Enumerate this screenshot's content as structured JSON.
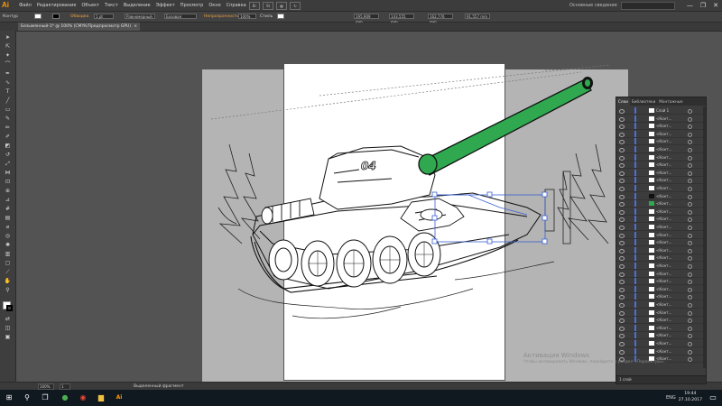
{
  "app": {
    "logo": "Ai",
    "workspace": "Основные сведения",
    "window_controls": [
      "—",
      "❐",
      "✕"
    ]
  },
  "menu": [
    "Файл",
    "Редактирование",
    "Объект",
    "Текст",
    "Выделение",
    "Эффект",
    "Просмотр",
    "Окно",
    "Справка"
  ],
  "menu_icons": [
    "Br",
    "St",
    "▦",
    "↻"
  ],
  "control": {
    "mode": "Контур",
    "stroke_label": "Обводка",
    "stroke_value": "1 pt",
    "profile": "Равномерный",
    "brush": "Базовая",
    "opacity_label": "Непрозрачность",
    "opacity_value": "100%",
    "style_label": "Стиль",
    "x_value": "195,909 mm",
    "y_value": "143,555 mm",
    "w_value": "162,776 mm",
    "h_value": "91,557 mm"
  },
  "document": {
    "tab": "Безымянный-1* @ 100% (CMYK/Предпросмотр GPU)",
    "close": "×"
  },
  "status": {
    "zoom": "100%",
    "page": "1",
    "selection": "Выделенный фрагмент"
  },
  "tank": {
    "label": "04"
  },
  "layers_panel": {
    "tabs": [
      "Слои",
      "Библиотеки",
      "Монтажные"
    ],
    "top_layer": "Слой 1",
    "sublayer_name": "<Конт...",
    "footer": "1 слой"
  },
  "watermark": {
    "line1": "Активация Windows",
    "line2": "Чтобы активировать Windows, перейдите в раздел «Параметры»."
  },
  "taskbar": {
    "time": "19:44",
    "date": "27.10.2017",
    "lang": "ENG"
  },
  "colors": {
    "cannon": "#2fa84f",
    "selection": "#3a5fd0",
    "orange": "#ff9a00"
  }
}
